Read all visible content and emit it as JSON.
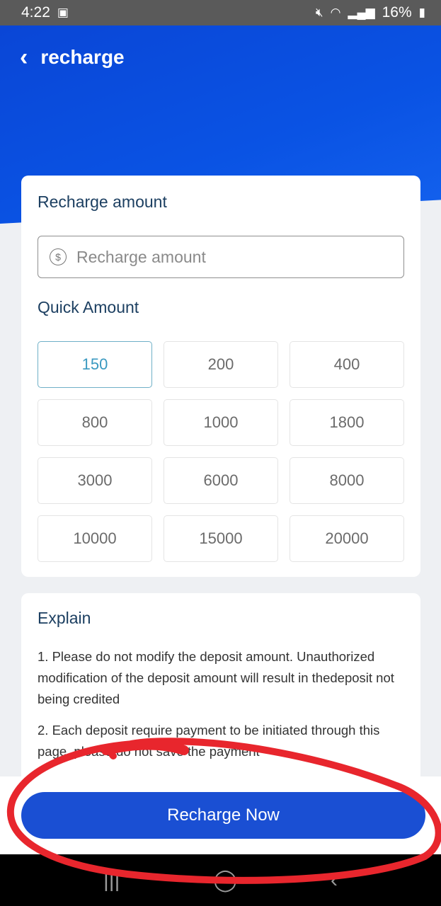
{
  "status_bar": {
    "time": "4:22",
    "battery": "16%",
    "icons": [
      "image-icon",
      "mute-icon",
      "wifi-icon",
      "signal-icon",
      "battery-icon"
    ]
  },
  "header": {
    "back_icon": "chevron-left-icon",
    "title": "recharge"
  },
  "recharge_card": {
    "title": "Recharge amount",
    "input_icon": "dollar-circle-icon",
    "input_placeholder": "Recharge amount",
    "input_value": "",
    "quick_title": "Quick Amount",
    "quick_amounts": [
      "150",
      "200",
      "400",
      "800",
      "1000",
      "1800",
      "3000",
      "6000",
      "8000",
      "10000",
      "15000",
      "20000"
    ],
    "selected_amount": "150"
  },
  "explain_card": {
    "title": "Explain",
    "items": [
      "1. Please do not modify the deposit amount. Unauthorized modification of the deposit amount will result in thedeposit not being credited",
      "2. Each deposit require payment to be initiated through this page, please do not save the payment"
    ]
  },
  "footer": {
    "button_label": "Recharge Now"
  },
  "nav_bar": {
    "icons": [
      "recent-apps-icon",
      "home-icon",
      "back-icon"
    ]
  },
  "colors": {
    "header": "#0a4fdd",
    "primary_button": "#1a4fd3",
    "selected_border": "#6fb0c7",
    "annotation": "#e8262d"
  }
}
